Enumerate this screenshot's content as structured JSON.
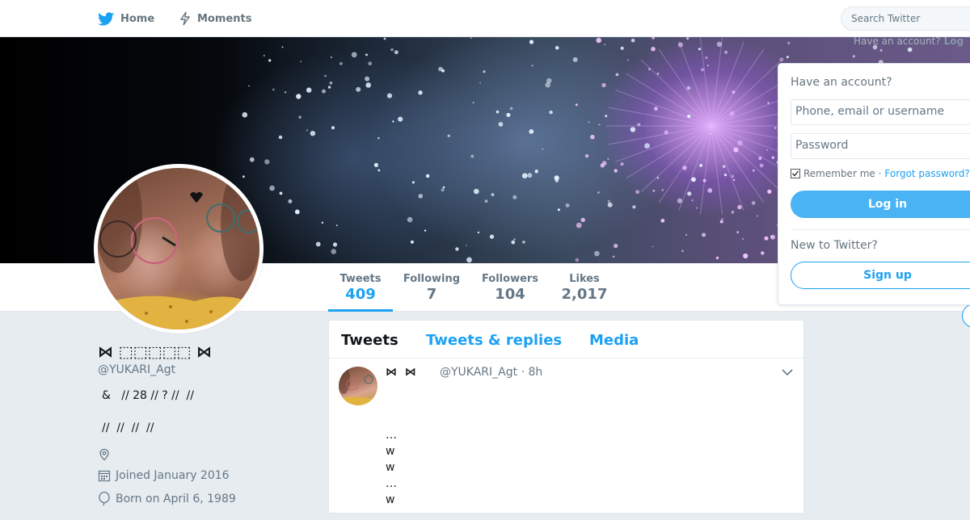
{
  "nav": {
    "home_label": "Home",
    "moments_label": "Moments",
    "search_placeholder": "Search Twitter",
    "have_account_label": "Have an account?",
    "login_label": "Log"
  },
  "profile": {
    "name": "⋈ ⬚⬚⬚⬚⬚ ⋈",
    "screen_name": "@YUKARI_Agt",
    "bio_line1": "&   // 28 // ? //  //",
    "bio_line2": "//  //  //  //",
    "joined": "Joined January 2016",
    "born": "Born on April 6, 1989"
  },
  "stats": [
    {
      "label": "Tweets",
      "value": "409"
    },
    {
      "label": "Following",
      "value": "7"
    },
    {
      "label": "Followers",
      "value": "104"
    },
    {
      "label": "Likes",
      "value": "2,017"
    }
  ],
  "timeline": {
    "tabs": [
      "Tweets",
      "Tweets & replies",
      "Media"
    ],
    "tweet": {
      "name": "⋈  ⋈",
      "handle_time": "@YUKARI_Agt · 8h",
      "lines": [
        "…",
        "w",
        "w",
        "…",
        "w"
      ]
    }
  },
  "login_panel": {
    "title": "Have an account?",
    "username_placeholder": "Phone, email or username",
    "password_placeholder": "Password",
    "remember_label": "Remember me ·",
    "forgot_label": "Forgot password?",
    "login_button": "Log in",
    "new_label": "New to Twitter?",
    "signup_button": "Sign up"
  },
  "colors": {
    "accent": "#1da1f2",
    "muted": "#657786",
    "background": "#e6ecf0"
  }
}
